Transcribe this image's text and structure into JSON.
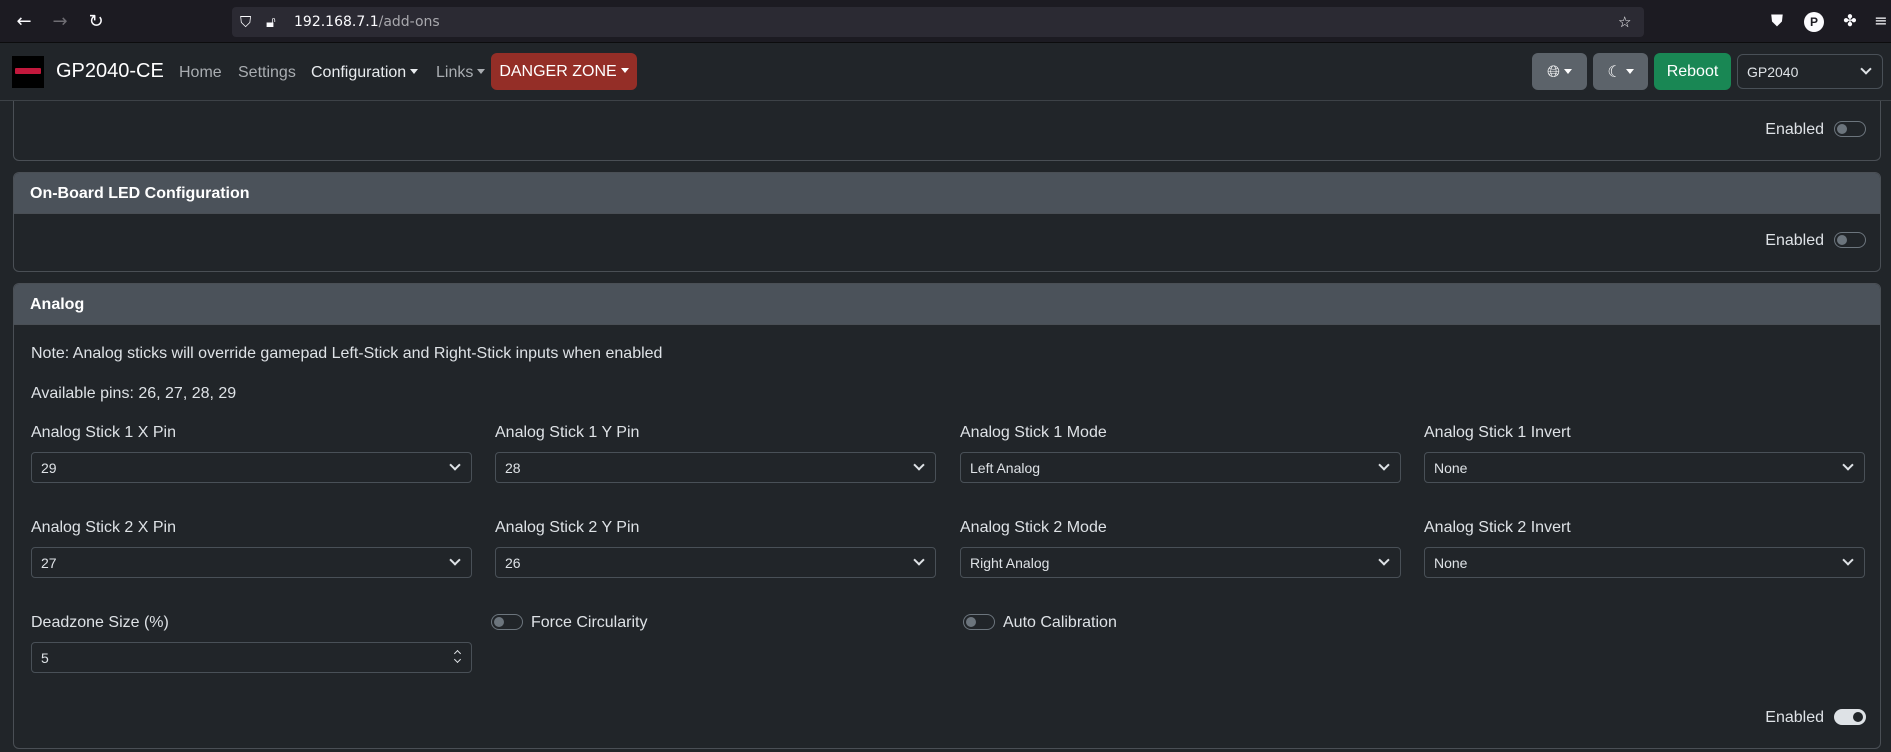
{
  "browser": {
    "url_host": "192.168.7.1",
    "url_path": "/add-ons",
    "profile_initial": "P"
  },
  "navbar": {
    "brand": "GP2040-CE",
    "links": [
      "Home",
      "Settings",
      "Configuration",
      "Links"
    ],
    "danger": "DANGER ZONE",
    "reboot": "Reboot",
    "board": "GP2040"
  },
  "colors": {
    "danger": "#942e27",
    "reboot": "#198754",
    "card_header": "#4b525a",
    "background": "#212529"
  },
  "top_card": {
    "enabled_label": "Enabled",
    "enabled": false
  },
  "led_card": {
    "title": "On-Board LED Configuration",
    "enabled_label": "Enabled",
    "enabled": false
  },
  "analog": {
    "title": "Analog",
    "note": "Note: Analog sticks will override gamepad Left-Stick and Right-Stick inputs when enabled",
    "pins": "Available pins: 26, 27, 28, 29",
    "row1": [
      {
        "label": "Analog Stick 1 X Pin",
        "value": "29"
      },
      {
        "label": "Analog Stick 1 Y Pin",
        "value": "28"
      },
      {
        "label": "Analog Stick 1 Mode",
        "value": "Left Analog"
      },
      {
        "label": "Analog Stick 1 Invert",
        "value": "None"
      }
    ],
    "row2": [
      {
        "label": "Analog Stick 2 X Pin",
        "value": "27"
      },
      {
        "label": "Analog Stick 2 Y Pin",
        "value": "26"
      },
      {
        "label": "Analog Stick 2 Mode",
        "value": "Right Analog"
      },
      {
        "label": "Analog Stick 2 Invert",
        "value": "None"
      }
    ],
    "deadzone_label": "Deadzone Size (%)",
    "deadzone_value": "5",
    "force_circularity": "Force Circularity",
    "force_circularity_on": false,
    "auto_calibration": "Auto Calibration",
    "auto_calibration_on": false,
    "enabled_label": "Enabled",
    "enabled": true
  }
}
